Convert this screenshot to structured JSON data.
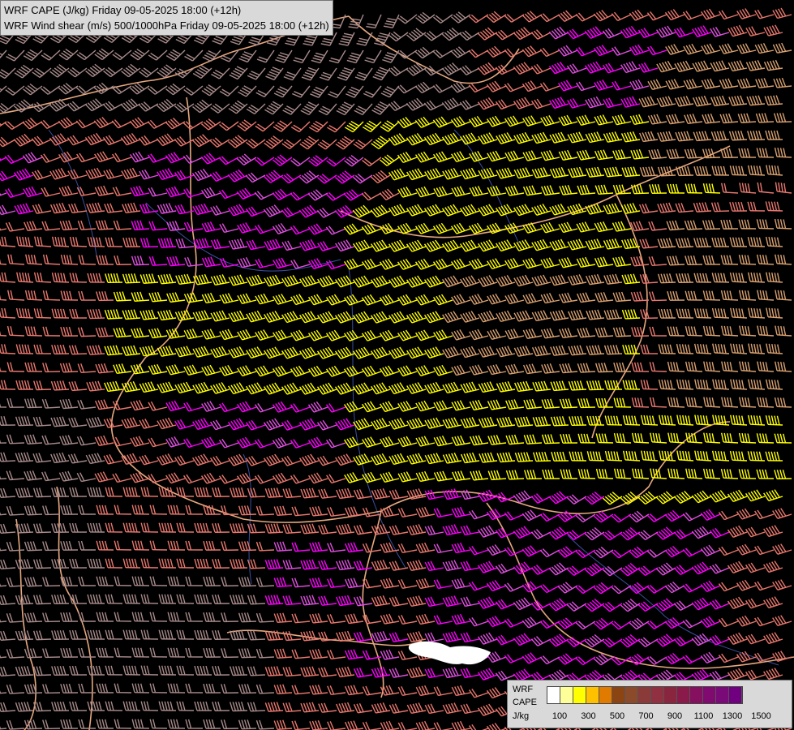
{
  "header": {
    "line1": "WRF CAPE (J/kg) Friday 09-05-2025 18:00 (+12h)",
    "line2": "WRF Wind shear (m/s) 500/1000hPa Friday 09-05-2025 18:00 (+12h)"
  },
  "legend": {
    "label1": "WRF",
    "label2": "CAPE",
    "label3": "J/kg",
    "colors": [
      "#ffffff",
      "#ffff99",
      "#ffff00",
      "#ffc000",
      "#e07b00",
      "#8b4513",
      "#8b4a2a",
      "#8b3a3a",
      "#903040",
      "#8a2540",
      "#8a1a4a",
      "#861060",
      "#800a70",
      "#7a0a78",
      "#700080"
    ],
    "ticks": [
      "100",
      "300",
      "500",
      "700",
      "900",
      "1100",
      "1300",
      "1500"
    ]
  },
  "colors": {
    "background": "#000000",
    "barb_gray": "#a88a8a",
    "barb_salmon": "#e8786e",
    "barb_pink": "#e050e0",
    "barb_magenta": "#ff00ff",
    "barb_yellow": "#ffff00",
    "barb_tan": "#d8a070",
    "border": "#e6a87e",
    "river": "#3a4fa0"
  }
}
